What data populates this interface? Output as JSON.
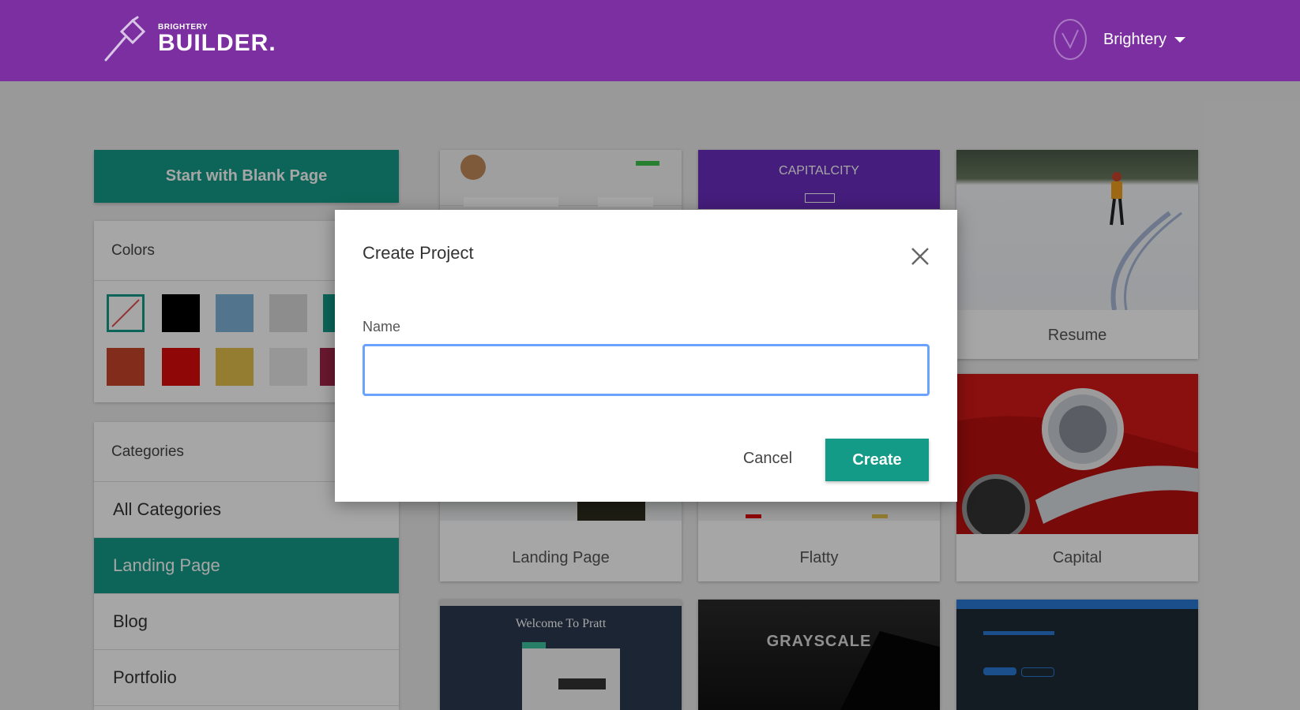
{
  "header": {
    "logo_small": "BRIGHTERY",
    "logo_big": "BUILDER.",
    "user_name": "Brightery"
  },
  "sidebar": {
    "blank_page_label": "Start with Blank Page",
    "colors_title": "Colors",
    "swatch_colors": [
      "none",
      "#000000",
      "#7fb3d9",
      "#d9d9d9",
      "#139b87",
      "#c8442c",
      "#dc0b0b",
      "#e3c04a",
      "#e8e8e8",
      "#a2254a"
    ],
    "categories_title": "Categories",
    "categories": [
      {
        "label": "All Categories",
        "active": false
      },
      {
        "label": "Landing Page",
        "active": true
      },
      {
        "label": "Blog",
        "active": false
      },
      {
        "label": "Portfolio",
        "active": false
      }
    ]
  },
  "templates": {
    "capitalcity_title": "CAPITALCITY",
    "resume_label": "Resume",
    "landing_label": "Landing Page",
    "flatty_label": "Flatty",
    "capital_label": "Capital",
    "pratt_title": "Welcome To Pratt",
    "grayscale_title": "GRAYSCALE"
  },
  "modal": {
    "title": "Create Project",
    "name_label": "Name",
    "name_value": "",
    "cancel_label": "Cancel",
    "create_label": "Create"
  },
  "colors": {
    "header": "#7b2fa0",
    "accent": "#139b87",
    "input_focus": "#6aa3ff"
  }
}
